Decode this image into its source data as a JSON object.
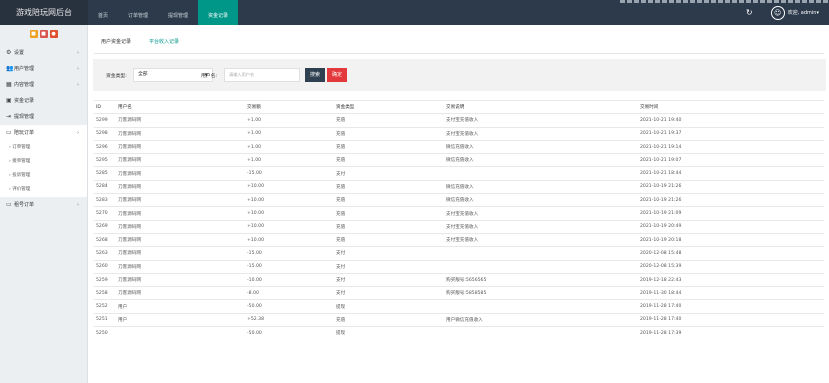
{
  "app_title": "游戏陪玩网后台",
  "nav": [
    "首页",
    "订单管理",
    "提现管理",
    "资金记录"
  ],
  "user_label": "欢迎, admin",
  "sidebar": {
    "items": [
      {
        "icon": "gear-icon",
        "glyph": "⚙",
        "label": "设置",
        "arrow": true
      },
      {
        "icon": "users-icon",
        "glyph": "👥",
        "label": "用户管理",
        "arrow": true
      },
      {
        "icon": "grid-icon",
        "glyph": "▦",
        "label": "内容管理",
        "arrow": true
      },
      {
        "icon": "wallet-icon",
        "glyph": "▣",
        "label": "资金记录",
        "arrow": false
      },
      {
        "icon": "withdraw-icon",
        "glyph": "⇥",
        "label": "提现管理",
        "arrow": false
      },
      {
        "icon": "monitor-icon",
        "glyph": "▭",
        "label": "陪玩订单",
        "arrow": true
      }
    ],
    "sub_items": [
      "订单管理",
      "接单管理",
      "投诉管理",
      "评价管理"
    ],
    "last_item": {
      "icon": "monitor-icon",
      "glyph": "▭",
      "label": "租号订单"
    }
  },
  "tabs": [
    "用户资金记录",
    "平台收入记录"
  ],
  "filter": {
    "type_label": "资金类型:",
    "type_value": "全部",
    "user_label": "用户名:",
    "user_placeholder": "请输入用户名",
    "search_btn": "搜索",
    "confirm_btn": "确定"
  },
  "table": {
    "headers": [
      "ID",
      "用户名",
      "交易额",
      "资金类型",
      "交易说明",
      "交易时间"
    ],
    "rows": [
      [
        "5299",
        "刀客源码网",
        "+1.00",
        "充值",
        "支付宝充值收入",
        "2021-10-21 19:40"
      ],
      [
        "5298",
        "刀客源码网",
        "+1.00",
        "充值",
        "支付宝充值收入",
        "2021-10-21 19:37"
      ],
      [
        "5296",
        "刀客源码网",
        "+1.00",
        "充值",
        "微信充值收入",
        "2021-10-21 19:14"
      ],
      [
        "5295",
        "刀客源码网",
        "+1.00",
        "充值",
        "微信充值收入",
        "2021-10-21 19:07"
      ],
      [
        "5285",
        "刀客源码网",
        "-15.00",
        "支付",
        "",
        "2021-10-21 18:44"
      ],
      [
        "5284",
        "刀客源码网",
        "+10.00",
        "充值",
        "微信充值收入",
        "2021-10-19 21:26"
      ],
      [
        "5283",
        "刀客源码网",
        "+10.00",
        "充值",
        "微信充值收入",
        "2021-10-19 21:26"
      ],
      [
        "5270",
        "刀客源码网",
        "+10.00",
        "充值",
        "支付宝充值收入",
        "2021-10-19 21:09"
      ],
      [
        "5269",
        "刀客源码网",
        "+10.00",
        "充值",
        "支付宝充值收入",
        "2021-10-19 20:49"
      ],
      [
        "5268",
        "刀客源码网",
        "+10.00",
        "充值",
        "支付宝充值收入",
        "2021-10-19 20:18"
      ],
      [
        "5263",
        "刀客源码网",
        "-15.00",
        "支付",
        "",
        "2020-12-08 15:48"
      ],
      [
        "5260",
        "刀客源码网",
        "-15.00",
        "支付",
        "",
        "2020-12-08 15:39"
      ],
      [
        "5259",
        "刀客源码网",
        "-10.00",
        "支付",
        "购买靓号:5656565",
        "2019-12-18 22:43"
      ],
      [
        "5258",
        "刀客源码网",
        "-8.00",
        "支付",
        "购买靓号:5858585",
        "2019-11-30 18:44"
      ],
      [
        "5252",
        "用户",
        "-50.00",
        "提现",
        "",
        "2019-11-28 17:40"
      ],
      [
        "5251",
        "用户",
        "+52.38",
        "充值",
        "用户微信充值收入",
        "2019-11-28 17:40"
      ],
      [
        "5250",
        "",
        "-50.00",
        "提现",
        "",
        "2019-11-28 17:39"
      ]
    ]
  }
}
